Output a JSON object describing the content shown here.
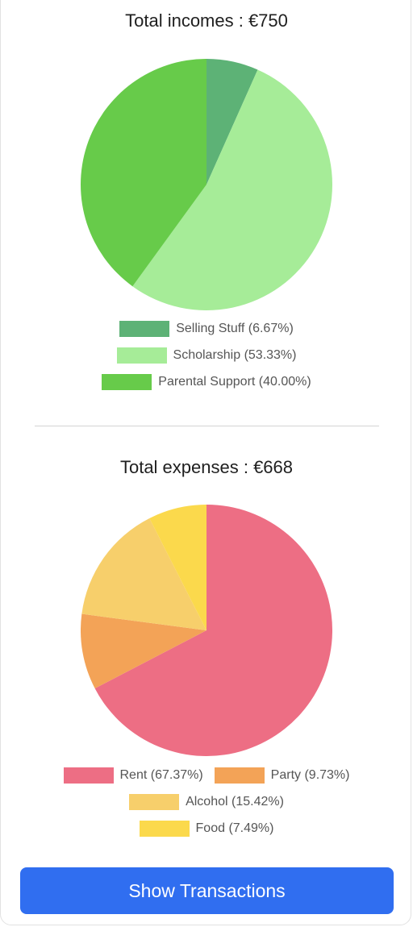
{
  "colors": {
    "button_bg": "#306ef0",
    "divider": "#d4d4d4"
  },
  "chart_data": [
    {
      "type": "pie",
      "title": "Total incomes : €750",
      "categories": [
        "Selling Stuff",
        "Scholarship",
        "Parental Support"
      ],
      "values": [
        6.67,
        53.33,
        40.0
      ],
      "labels": [
        "Selling Stuff (6.67%)",
        "Scholarship (53.33%)",
        "Parental Support (40.00%)"
      ],
      "colors": [
        "#5db276",
        "#a6ec98",
        "#67cb4a"
      ],
      "legend_position": "bottom",
      "legend_rows": [
        [
          0
        ],
        [
          1
        ],
        [
          2
        ]
      ]
    },
    {
      "type": "pie",
      "title": "Total expenses : €668",
      "categories": [
        "Rent",
        "Party",
        "Alcohol",
        "Food"
      ],
      "values": [
        67.37,
        9.73,
        15.42,
        7.49
      ],
      "labels": [
        "Rent (67.37%)",
        "Party (9.73%)",
        "Alcohol (15.42%)",
        "Food (7.49%)"
      ],
      "colors": [
        "#ed6e84",
        "#f3a357",
        "#f7cf6b",
        "#fbd94c"
      ],
      "legend_position": "bottom",
      "legend_rows": [
        [
          0,
          1
        ],
        [
          2
        ],
        [
          3
        ]
      ]
    }
  ],
  "actions": {
    "show_transactions_label": "Show Transactions"
  }
}
